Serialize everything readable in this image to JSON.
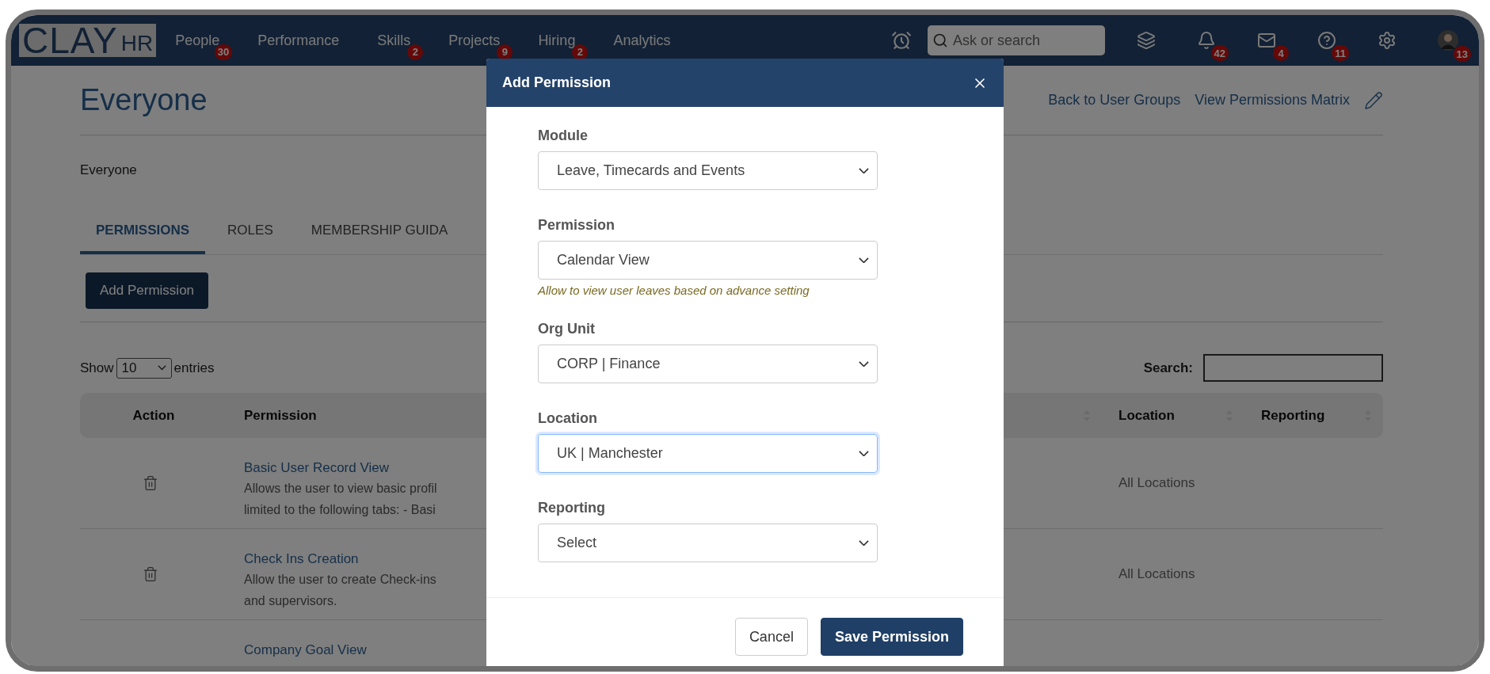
{
  "nav": {
    "logo": {
      "main": "CLAY",
      "sub": "HR"
    },
    "items": [
      {
        "label": "People",
        "badge": "30"
      },
      {
        "label": "Performance"
      },
      {
        "label": "Skills",
        "badge": "2"
      },
      {
        "label": "Projects",
        "badge": "9"
      },
      {
        "label": "Hiring",
        "badge": "2"
      },
      {
        "label": "Analytics"
      }
    ]
  },
  "toolbar": {
    "search": {
      "placeholder": "Ask or search"
    },
    "icons": [
      {
        "kind": "layers"
      },
      {
        "kind": "bell",
        "badge": "42"
      },
      {
        "kind": "mail",
        "badge": "4"
      },
      {
        "kind": "help",
        "badge": "11"
      },
      {
        "kind": "settings"
      },
      {
        "kind": "avatar",
        "badge": "13"
      }
    ]
  },
  "page": {
    "title": "Everyone",
    "links": [
      "Back to User Groups",
      "View Permissions Matrix"
    ],
    "subtitle": "Everyone",
    "tabs": [
      {
        "label": "PERMISSIONS",
        "selected": true
      },
      {
        "label": "ROLES",
        "selected": false
      },
      {
        "label": "MEMBERSHIP GUIDA",
        "selected": false
      }
    ],
    "add_button": "Add Permission"
  },
  "table": {
    "show_label": "Show",
    "page_size": "10",
    "entries_label": "entries",
    "search_label": "Search:",
    "columns": [
      "Action",
      "Permission",
      "",
      "Location",
      "Reporting"
    ],
    "rows": [
      {
        "title": "Basic User Record View",
        "description": [
          "Allows the user to view basic profil",
          "limited to the following tabs: - Basi"
        ],
        "location": "All Locations"
      },
      {
        "title": "Check Ins Creation",
        "description": [
          "Allow the user to create Check-ins",
          "and supervisors."
        ],
        "location": "All Locations"
      },
      {
        "title": "Company Goal View"
      }
    ]
  },
  "modal": {
    "title": "Add Permission",
    "fields": [
      {
        "label": "Module",
        "value": "Leave, Timecards and Events",
        "focused": false
      },
      {
        "label": "Permission",
        "value": "Calendar View",
        "hint": "Allow to view user leaves based on advance setting",
        "focused": false
      },
      {
        "label": "Org Unit",
        "value": "CORP | Finance",
        "focused": false
      },
      {
        "label": "Location",
        "value": "UK | Manchester",
        "focused": true
      },
      {
        "label": "Reporting",
        "value": "Select",
        "focused": false
      }
    ],
    "buttons": [
      {
        "label": "Cancel",
        "kind": "secondary"
      },
      {
        "label": "Save Permission",
        "kind": "primary"
      }
    ]
  }
}
